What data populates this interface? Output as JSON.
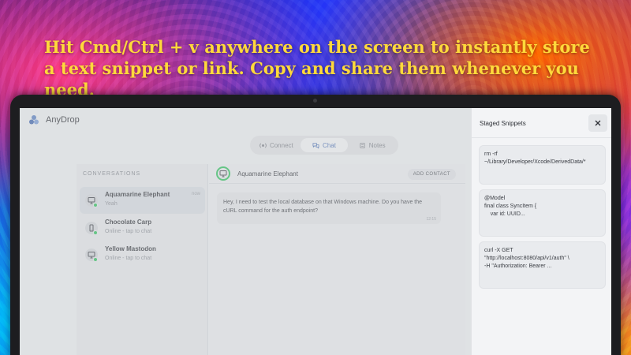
{
  "headline": "Hit Cmd/Ctrl + v anywhere on the screen to instantly store a text snippet or link. Copy and share them whenever you need.",
  "app": {
    "name": "AnyDrop",
    "tabs": [
      {
        "label": "Connect",
        "icon": "radio-icon",
        "active": false
      },
      {
        "label": "Chat",
        "icon": "chat-bubbles-icon",
        "active": true
      },
      {
        "label": "Notes",
        "icon": "note-icon",
        "active": false
      }
    ]
  },
  "conversations": {
    "header": "CONVERSATIONS",
    "items": [
      {
        "name": "Aquamarine Elephant",
        "subtitle": "Yeah",
        "time": "now",
        "device": "desktop-icon",
        "online": true,
        "selected": true
      },
      {
        "name": "Chocolate Carp",
        "subtitle": "Online - tap to chat",
        "time": "",
        "device": "phone-icon",
        "online": true,
        "selected": false
      },
      {
        "name": "Yellow Mastodon",
        "subtitle": "Online - tap to chat",
        "time": "",
        "device": "desktop-icon",
        "online": true,
        "selected": false
      }
    ]
  },
  "chat": {
    "title": "Aquamarine Elephant",
    "add_contact_label": "ADD CONTACT",
    "messages": [
      {
        "text": "Hey, I need to test the local database on that Windows machine. Do you have the cURL command for the auth endpoint?",
        "time": "12:15"
      }
    ]
  },
  "staged": {
    "title": "Staged Snippets",
    "snippets": [
      "rm -rf\n~/Library/Developer/Xcode/DerivedData/*",
      "@Model\nfinal class SyncItem {\n    var id: UUID...",
      "curl -X GET\n\"http://localhost:8080/api/v1/auth\" \\\n-H \"Authorization: Bearer ..."
    ]
  },
  "colors": {
    "headline": "#ffd93b",
    "online": "#2fbf5c",
    "accent": "#4a6fb2"
  }
}
